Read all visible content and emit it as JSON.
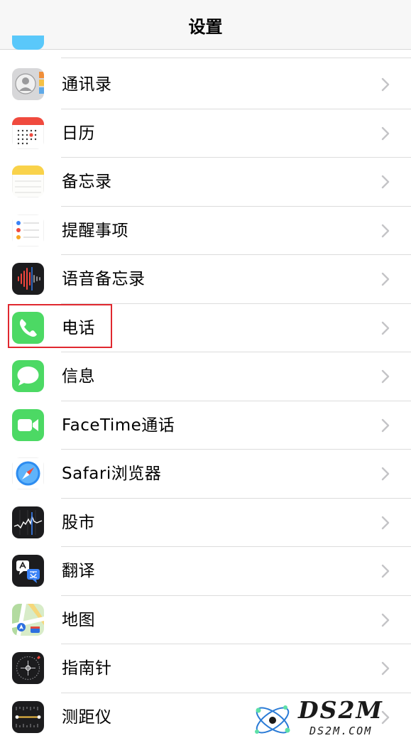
{
  "navbar": {
    "title": "设置"
  },
  "rows": [
    {
      "label": "通讯录",
      "icon": "contacts-icon"
    },
    {
      "label": "日历",
      "icon": "calendar-icon"
    },
    {
      "label": "备忘录",
      "icon": "notes-icon"
    },
    {
      "label": "提醒事项",
      "icon": "reminders-icon"
    },
    {
      "label": "语音备忘录",
      "icon": "voice-memos-icon"
    },
    {
      "label": "电话",
      "icon": "phone-icon",
      "highlighted": true
    },
    {
      "label": "信息",
      "icon": "messages-icon"
    },
    {
      "label": "FaceTime通话",
      "icon": "facetime-icon"
    },
    {
      "label": "Safari浏览器",
      "icon": "safari-icon"
    },
    {
      "label": "股市",
      "icon": "stocks-icon"
    },
    {
      "label": "翻译",
      "icon": "translate-icon"
    },
    {
      "label": "地图",
      "icon": "maps-icon"
    },
    {
      "label": "指南针",
      "icon": "compass-icon"
    },
    {
      "label": "测距仪",
      "icon": "measure-icon"
    }
  ],
  "watermark": {
    "brand": "DS2M",
    "domain": "DS2M.COM"
  },
  "colors": {
    "highlight": "#e0282f",
    "phone_green": "#4cd964",
    "separator": "#dcdcdc",
    "chevron": "#c4c4c7"
  }
}
